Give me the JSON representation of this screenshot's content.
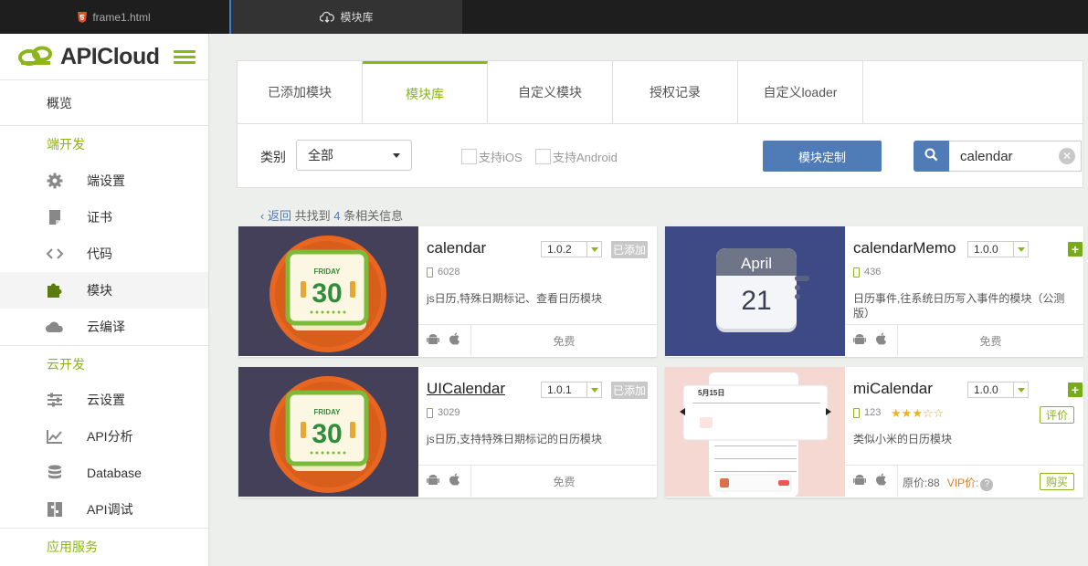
{
  "window_tabs": [
    {
      "label": "frame1.html",
      "icon": "html5-icon"
    },
    {
      "label": "模块库",
      "icon": "cloud-download-icon"
    }
  ],
  "sidebar": {
    "brand": "APICloud",
    "overview": "概览",
    "sections": [
      {
        "title": "端开发",
        "items": [
          {
            "label": "端设置",
            "icon": "gear-icon"
          },
          {
            "label": "证书",
            "icon": "certificate-icon"
          },
          {
            "label": "代码",
            "icon": "code-icon"
          },
          {
            "label": "模块",
            "icon": "puzzle-icon",
            "active": true
          },
          {
            "label": "云编译",
            "icon": "cloud-icon"
          }
        ]
      },
      {
        "title": "云开发",
        "items": [
          {
            "label": "云设置",
            "icon": "sliders-icon"
          },
          {
            "label": "API分析",
            "icon": "chart-icon"
          },
          {
            "label": "Database",
            "icon": "database-icon"
          },
          {
            "label": "API调试",
            "icon": "debug-icon"
          }
        ]
      },
      {
        "title": "应用服务",
        "items": []
      }
    ]
  },
  "main_tabs": [
    "已添加模块",
    "模块库",
    "自定义模块",
    "授权记录",
    "自定义loader"
  ],
  "active_tab": "模块库",
  "filter": {
    "category_label": "类别",
    "category_value": "全部",
    "ios_label": "支持iOS",
    "android_label": "支持Android",
    "custom_button": "模块定制",
    "search_value": "calendar"
  },
  "result": {
    "back": "返回",
    "prefix": "共找到",
    "count": "4",
    "suffix": "条相关信息"
  },
  "modules": [
    {
      "name": "calendar",
      "version": "1.0.2",
      "status": "已添加",
      "count": "6028",
      "desc": "js日历,特殊日期标记、查看日历模块",
      "price": "免费"
    },
    {
      "name": "calendarMemo",
      "version": "1.0.0",
      "status": "+",
      "count": "436",
      "desc": "日历事件,往系统日历写入事件的模块（公测版）",
      "price": "免费",
      "thumb_month": "April",
      "thumb_day": "21"
    },
    {
      "name": "UICalendar",
      "version": "1.0.1",
      "status": "已添加",
      "count": "3029",
      "desc": "js日历,支持特殊日期标记的日历模块",
      "price": "免费"
    },
    {
      "name": "miCalendar",
      "version": "1.0.0",
      "status": "+",
      "count": "123",
      "rating": 3,
      "max_rating": 5,
      "rate_label": "评价",
      "desc": "类似小米的日历模块",
      "orig_price": "原价:88",
      "vip_label": "VIP价:",
      "buy_label": "购买",
      "thumb_date": "5月15日"
    }
  ],
  "thumb_text": {
    "weekday": "FRIDAY",
    "day": "30"
  },
  "colors": {
    "accent": "#8cb51a",
    "blue": "#4f7bb6",
    "thumb_bg": "#45405a",
    "memo_bg": "#3d4a86"
  }
}
